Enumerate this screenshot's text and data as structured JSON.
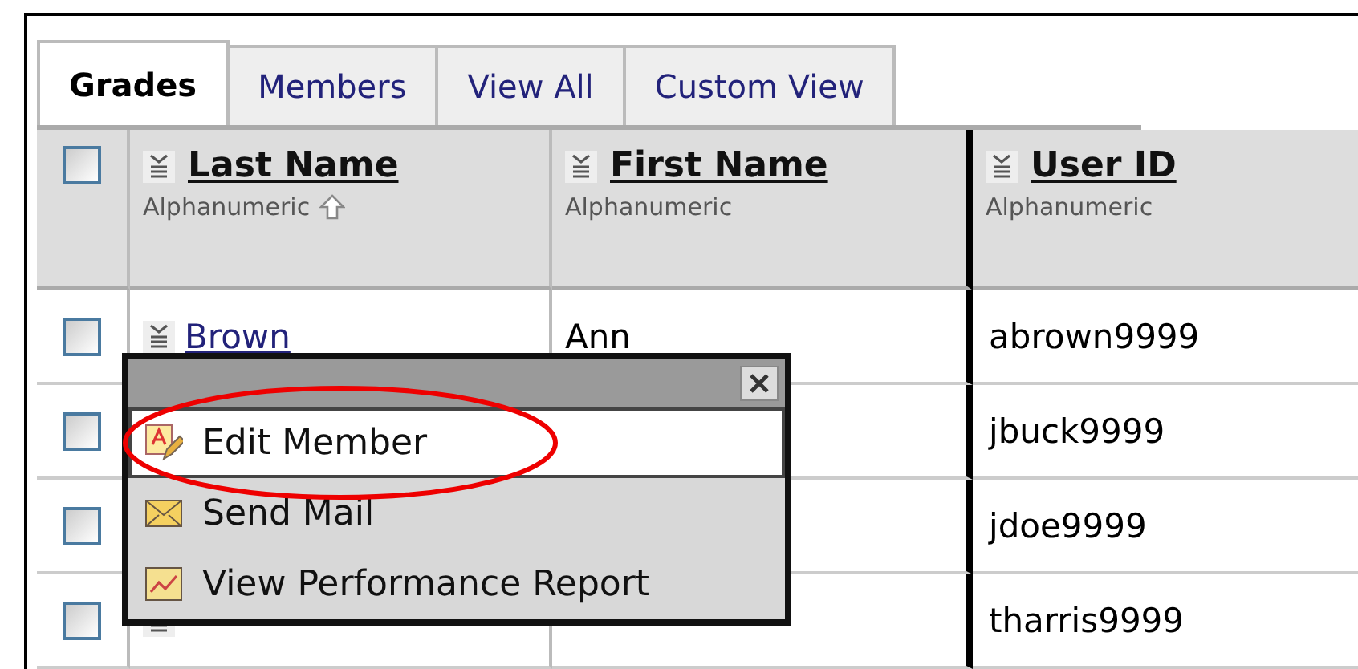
{
  "tabs": [
    {
      "label": "Grades",
      "selected": true
    },
    {
      "label": "Members",
      "selected": false
    },
    {
      "label": "View All",
      "selected": false
    },
    {
      "label": "Custom View",
      "selected": false
    }
  ],
  "table": {
    "select_all": {
      "checked": false
    },
    "columns": [
      {
        "title": "Last Name",
        "subtitle": "Alphanumeric",
        "sorted": true
      },
      {
        "title": "First Name",
        "subtitle": "Alphanumeric",
        "sorted": false
      },
      {
        "title": "User ID",
        "subtitle": "Alphanumeric",
        "sorted": false
      }
    ],
    "rows": [
      {
        "checked": false,
        "last_name": "Brown",
        "first_name": "Ann",
        "user_id": "abrown9999"
      },
      {
        "checked": false,
        "user_id": "jbuck9999"
      },
      {
        "checked": false,
        "user_id": "jdoe9999"
      },
      {
        "checked": false,
        "user_id": "tharris9999"
      }
    ]
  },
  "popup": {
    "items": [
      {
        "label": "Edit Member",
        "kind": "edit",
        "selected": true
      },
      {
        "label": "Send Mail",
        "kind": "mail",
        "selected": false
      },
      {
        "label": "View Performance Report",
        "kind": "chart",
        "selected": false
      }
    ]
  }
}
